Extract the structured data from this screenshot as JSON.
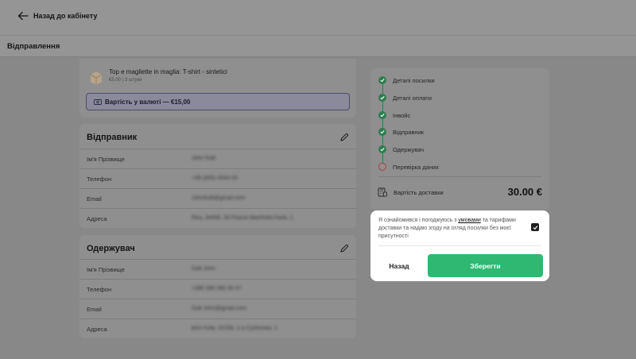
{
  "header": {
    "back_label": "Назад до кабінету",
    "section_title": "Відправлення"
  },
  "product": {
    "title": "Top e magliette in maglia: T-shirt - sintetici",
    "subtitle": "€5,00 | 3 штуки",
    "currency_value_label": "Вартість у валюті — €15,00"
  },
  "sender": {
    "title": "Відправник",
    "rows": [
      {
        "label": "Ім'я Прізвище",
        "value": "John Galt"
      },
      {
        "label": "Телефон",
        "value": "+38 (555) 4443-33"
      },
      {
        "label": "Email",
        "value": "JohnGalt@gmail.com"
      },
      {
        "label": "Адреса",
        "value": "Rea, 34456, 33 Piazza Manfredo Fanti, 1"
      }
    ]
  },
  "recipient": {
    "title": "Одержувач",
    "rows": [
      {
        "label": "Ім'я Прізвище",
        "value": "Galt John"
      },
      {
        "label": "Телефон",
        "value": "+380 066 395 00 07"
      },
      {
        "label": "Email",
        "value": "Galt.John@gmail.com"
      },
      {
        "label": "Адреса",
        "value": "вігіл Kola, 02160, 1-a Cyshnoea, 1"
      }
    ]
  },
  "steps": [
    {
      "label": "Деталі посилки",
      "done": true
    },
    {
      "label": "Деталі оплати",
      "done": true
    },
    {
      "label": "Інвойс",
      "done": true
    },
    {
      "label": "Відправник",
      "done": true
    },
    {
      "label": "Одержувач",
      "done": true
    },
    {
      "label": "Перевірка даних",
      "done": false
    }
  ],
  "delivery": {
    "label": "Вартість доставки",
    "value": "30.00 €"
  },
  "confirm": {
    "text_before": "Я ознайомився і погоджуюсь з ",
    "link": "умовами",
    "text_after": " та тарифами доставки та надаю згоду на огляд посилки без моєї присутності",
    "checked": true,
    "back_label": "Назад",
    "save_label": "Зберегти"
  },
  "colors": {
    "accent_green": "#2eb872",
    "step_green": "#2e7d4f",
    "currency_border": "#4c4c66"
  }
}
